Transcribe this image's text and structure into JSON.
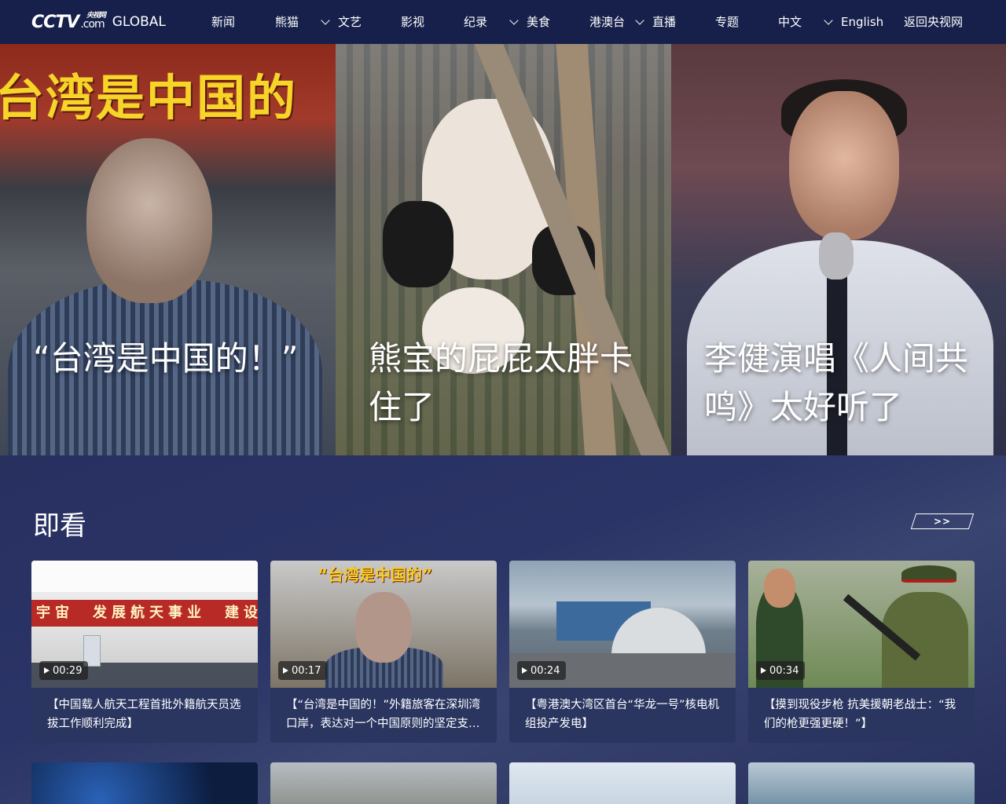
{
  "header": {
    "logo": {
      "main": "CCTV",
      "small": "央视网",
      "com": ".com",
      "global": "GLOBAL"
    },
    "nav": [
      {
        "label": "新闻",
        "dropdown": false
      },
      {
        "label": "熊猫",
        "dropdown": true
      },
      {
        "label": "文艺",
        "dropdown": false
      },
      {
        "label": "影视",
        "dropdown": false
      },
      {
        "label": "纪录",
        "dropdown": true
      },
      {
        "label": "美食",
        "dropdown": false
      },
      {
        "label": "港澳台",
        "dropdown": true
      },
      {
        "label": "直播",
        "dropdown": false
      },
      {
        "label": "专题",
        "dropdown": false
      },
      {
        "label": "中文",
        "dropdown": true
      },
      {
        "label": "English",
        "dropdown": false
      },
      {
        "label": "返回央视网",
        "dropdown": false
      }
    ]
  },
  "hero": [
    {
      "caption": "“台湾是中国的！”",
      "banner": "台湾是中国的"
    },
    {
      "caption": "熊宝的屁屁太胖卡住了"
    },
    {
      "caption": "李健演唱《人间共鸣》太好听了"
    }
  ],
  "section": {
    "title": "即看",
    "more_label": ">>",
    "cards": [
      {
        "duration": "00:29",
        "title": "【中国载人航天工程首批外籍航天员选拔工作顺利完成】",
        "thumb_text": "宇宙　发展航天事业　建设"
      },
      {
        "duration": "00:17",
        "title": "【“台湾是中国的！”外籍旅客在深圳湾口岸，表达对一个中国原则的坚定支持】",
        "thumb_text": "“台湾是中国的”"
      },
      {
        "duration": "00:24",
        "title": "【粤港澳大湾区首台“华龙一号”核电机组投产发电】"
      },
      {
        "duration": "00:34",
        "title": "【摸到现役步枪 抗美援朝老战士：“我们的枪更强更硬！”】"
      }
    ]
  },
  "colors": {
    "nav_bg": "#16204a",
    "page_bg": "#1e2547",
    "card_bg": "#2a3560",
    "accent_yellow": "#f7d428"
  }
}
